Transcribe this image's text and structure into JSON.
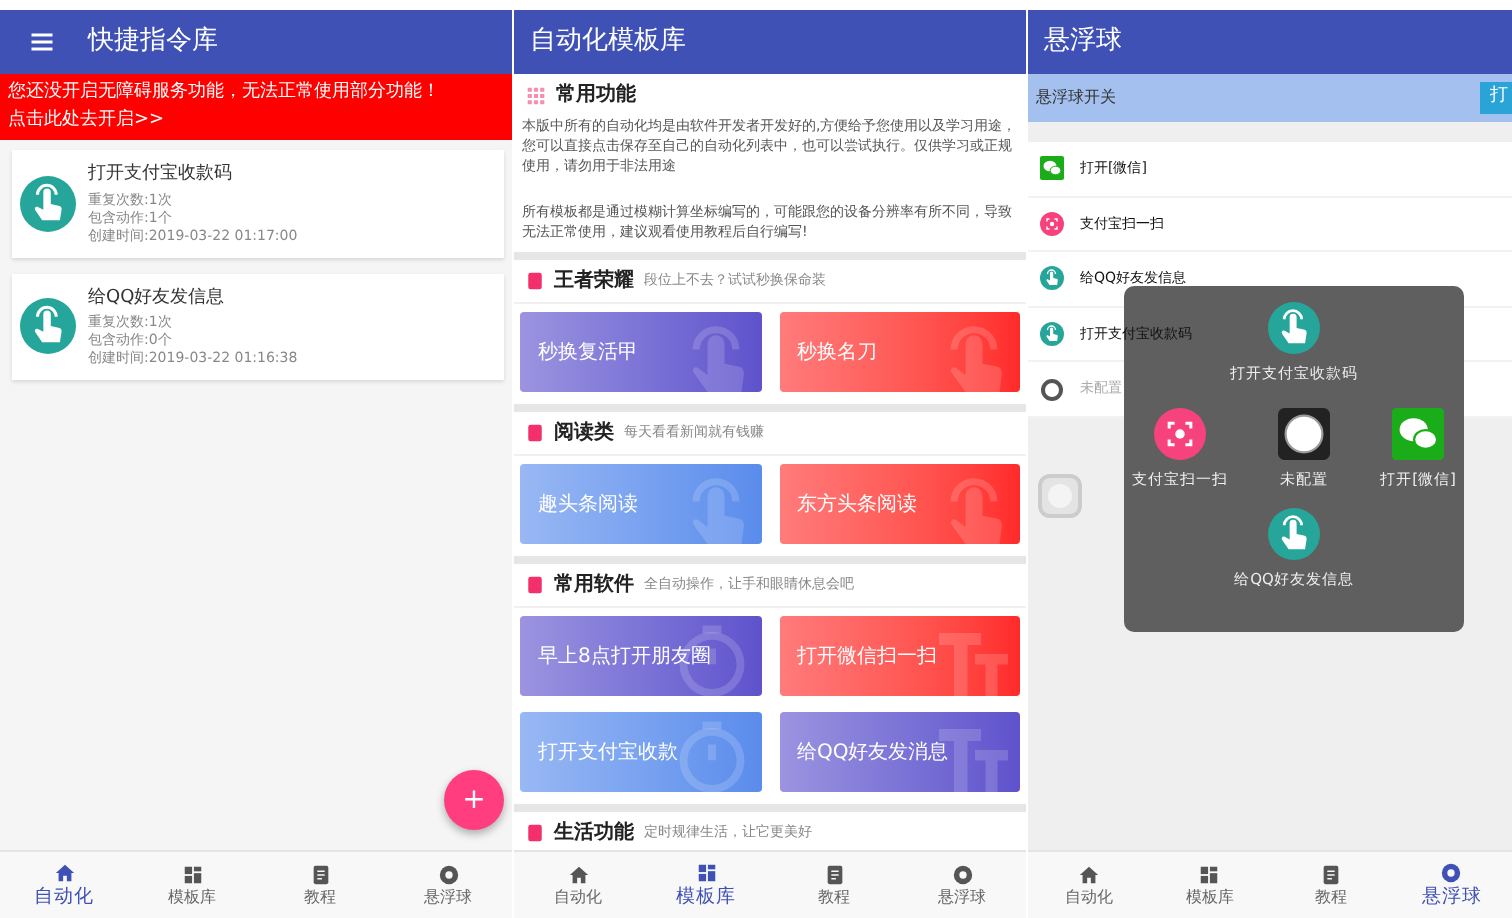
{
  "panels": [
    {
      "kind": "shortcuts",
      "title": "快捷指令库",
      "banner": [
        "您还没开启无障碍服务功能，无法正常使用部分功能！",
        "点击此处去开启>>"
      ],
      "commands": [
        {
          "title": "打开支付宝收款码",
          "details": [
            "重复次数:1次",
            "包含动作:1个",
            "创建时间:2019-03-22 01:17:00"
          ]
        },
        {
          "title": "给QQ好友发信息",
          "details": [
            "重复次数:1次",
            "包含动作:0个",
            "创建时间:2019-03-22 01:16:38"
          ]
        }
      ],
      "fab": "+",
      "nav": [
        {
          "label": "自动化",
          "selected": true
        },
        {
          "label": "模板库",
          "selected": false
        },
        {
          "label": "教程",
          "selected": false
        },
        {
          "label": "悬浮球",
          "selected": false
        }
      ]
    },
    {
      "kind": "templates",
      "title": "自动化模板库",
      "intro": {
        "title": "常用功能",
        "paragraphs": [
          "本版中所有的自动化均是由软件开发者开发好的,方便给予您使用以及学习用途，您可以直接点击保存至自己的自动化列表中，也可以尝试执行。仅供学习或正规使用，请勿用于非法用途",
          "所有模板都是通过模糊计算坐标编写的，可能跟您的设备分辨率有所不同，导致无法正常使用，建议观看使用教程后自行编写!"
        ]
      },
      "sections": [
        {
          "title": "王者荣耀",
          "subtitle": "段位上不去？试试秒换保命装",
          "tiles": [
            {
              "label": "秒换复活甲",
              "color": "#5f52cc",
              "kind": "hand"
            },
            {
              "label": "秒换名刀",
              "color": "#ff2a2a",
              "kind": "hand"
            }
          ]
        },
        {
          "title": "阅读类",
          "subtitle": "每天看看新闻就有钱赚",
          "tiles": [
            {
              "label": "趣头条阅读",
              "color": "#5a8cec",
              "kind": "hand"
            },
            {
              "label": "东方头条阅读",
              "color": "#ff2a2a",
              "kind": "hand"
            }
          ]
        },
        {
          "title": "常用软件",
          "subtitle": "全自动操作，让手和眼睛休息会吧",
          "tiles": [
            {
              "label": "早上8点打开朋友圈",
              "color": "#5f52cc",
              "kind": "timer"
            },
            {
              "label": "打开微信扫一扫",
              "color": "#ff2a2a",
              "kind": "text"
            },
            {
              "label": "打开支付宝收款",
              "color": "#5a8cec",
              "kind": "timer"
            },
            {
              "label": "给QQ好友发消息",
              "color": "#5f52cc",
              "kind": "text"
            }
          ]
        },
        {
          "title": "生活功能",
          "subtitle": "定时规律生活，让它更美好"
        }
      ],
      "nav": [
        {
          "label": "自动化",
          "selected": false
        },
        {
          "label": "模板库",
          "selected": true
        },
        {
          "label": "教程",
          "selected": false
        },
        {
          "label": "悬浮球",
          "selected": false
        }
      ]
    },
    {
      "kind": "floating",
      "title": "悬浮球",
      "switch": {
        "label": "悬浮球开关",
        "button": "打"
      },
      "actions": [
        {
          "label": "打开[微信]",
          "kind": "wechat",
          "disabled": false
        },
        {
          "label": "支付宝扫一扫",
          "kind": "scan",
          "disabled": false
        },
        {
          "label": "给QQ好友发信息",
          "kind": "tap",
          "disabled": false
        },
        {
          "label": "打开支付宝收款码",
          "kind": "tap",
          "disabled": false
        },
        {
          "label": "未配置",
          "kind": "empty",
          "disabled": true
        }
      ],
      "popup": {
        "top": {
          "label": "打开支付宝收款码",
          "kind": "tap"
        },
        "middle": [
          {
            "label": "支付宝扫一扫",
            "kind": "scan"
          },
          {
            "label": "未配置",
            "kind": "empty"
          },
          {
            "label": "打开[微信]",
            "kind": "wechat"
          }
        ],
        "bottom": {
          "label": "给QQ好友发信息",
          "kind": "tap"
        }
      },
      "nav": [
        {
          "label": "自动化",
          "selected": false
        },
        {
          "label": "模板库",
          "selected": false
        },
        {
          "label": "教程",
          "selected": false
        },
        {
          "label": "悬浮球",
          "selected": true
        }
      ]
    }
  ]
}
